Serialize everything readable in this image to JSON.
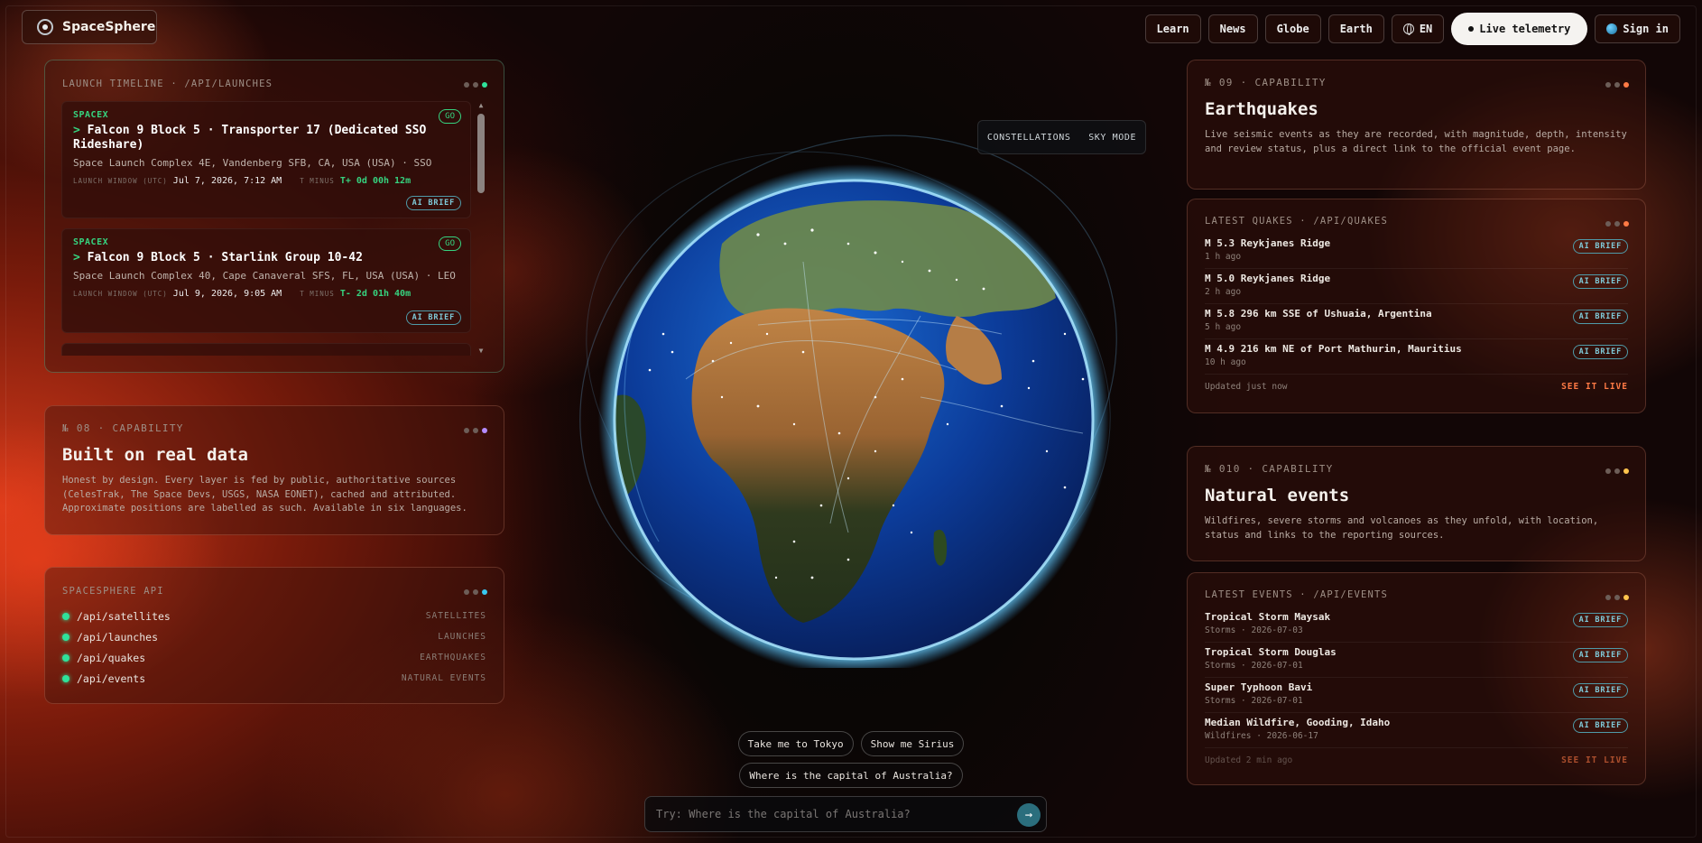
{
  "brand": {
    "name": "SpaceSphere"
  },
  "nav": {
    "learn": "Learn",
    "news": "News",
    "globe": "Globe",
    "earth": "Earth",
    "lang": "EN",
    "live": "Live telemetry",
    "signin": "Sign in"
  },
  "launches": {
    "title": "LAUNCH TIMELINE · /API/LAUNCHES",
    "items": [
      {
        "provider": "SPACEX",
        "status": "GO",
        "name": "Falcon 9 Block 5 · Transporter 17 (Dedicated SSO Rideshare)",
        "pad": "Space Launch Complex 4E, Vandenberg SFB, CA, USA (USA) · SSO",
        "window_label": "LAUNCH WINDOW (UTC)",
        "window": "Jul 7, 2026, 7:12 AM",
        "tminus_label": "T MINUS",
        "tminus": "T+ 0d 00h 12m",
        "brief": "AI BRIEF"
      },
      {
        "provider": "SPACEX",
        "status": "GO",
        "name": "Falcon 9 Block 5 · Starlink Group 10-42",
        "pad": "Space Launch Complex 40, Cape Canaveral SFS, FL, USA (USA) · LEO",
        "window_label": "LAUNCH WINDOW (UTC)",
        "window": "Jul 9, 2026, 9:05 AM",
        "tminus_label": "T MINUS",
        "tminus": "T- 2d 01h 40m",
        "brief": "AI BRIEF"
      }
    ]
  },
  "cap08": {
    "no": "№ 08 · CAPABILITY",
    "title": "Built on real data",
    "desc": "Honest by design. Every layer is fed by public, authoritative sources (CelesTrak, The Space Devs, USGS, NASA EONET), cached and attributed. Approximate positions are labelled as such. Available in six languages."
  },
  "api": {
    "title": "SPACESPHERE API",
    "rows": [
      {
        "path": "/api/satellites",
        "label": "SATELLITES"
      },
      {
        "path": "/api/launches",
        "label": "LAUNCHES"
      },
      {
        "path": "/api/quakes",
        "label": "EARTHQUAKES"
      },
      {
        "path": "/api/events",
        "label": "NATURAL EVENTS"
      }
    ]
  },
  "cap09": {
    "no": "№ 09 · CAPABILITY",
    "title": "Earthquakes",
    "desc": "Live seismic events as they are recorded, with magnitude, depth, intensity and review status, plus a direct link to the official event page."
  },
  "quakes": {
    "title": "LATEST QUAKES · /API/QUAKES",
    "items": [
      {
        "title": "M 5.3 Reykjanes Ridge",
        "ago": "1 h ago"
      },
      {
        "title": "M 5.0 Reykjanes Ridge",
        "ago": "2 h ago"
      },
      {
        "title": "M 5.8 296 km SSE of Ushuaia, Argentina",
        "ago": "5 h ago"
      },
      {
        "title": "M 4.9 216 km NE of Port Mathurin, Mauritius",
        "ago": "10 h ago"
      }
    ],
    "brief": "AI BRIEF",
    "updated": "Updated just now",
    "see": "SEE IT LIVE"
  },
  "cap010": {
    "no": "№ 010 · CAPABILITY",
    "title": "Natural events",
    "desc": "Wildfires, severe storms and volcanoes as they unfold, with location, status and links to the reporting sources."
  },
  "events": {
    "title": "LATEST EVENTS · /API/EVENTS",
    "items": [
      {
        "title": "Tropical Storm Maysak",
        "meta": "Storms · 2026-07-03"
      },
      {
        "title": "Tropical Storm Douglas",
        "meta": "Storms · 2026-07-01"
      },
      {
        "title": "Super Typhoon Bavi",
        "meta": "Storms · 2026-07-01"
      },
      {
        "title": "Median Wildfire, Gooding, Idaho",
        "meta": "Wildfires · 2026-06-17"
      }
    ],
    "brief": "AI BRIEF",
    "updated": "Updated 2 min ago",
    "see": "SEE IT LIVE"
  },
  "sky": {
    "constellations": "CONSTELLATIONS",
    "skymode": "SKY MODE"
  },
  "chips": [
    "Take me to Tokyo",
    "Show me Sirius",
    "Where is the capital of Australia?"
  ],
  "ask": {
    "placeholder": "Try: Where is the capital of Australia?"
  },
  "colors": {
    "accent_green": "#2fe29a",
    "accent_orange": "#ff7a45",
    "accent_teal": "#4f9aa8"
  }
}
